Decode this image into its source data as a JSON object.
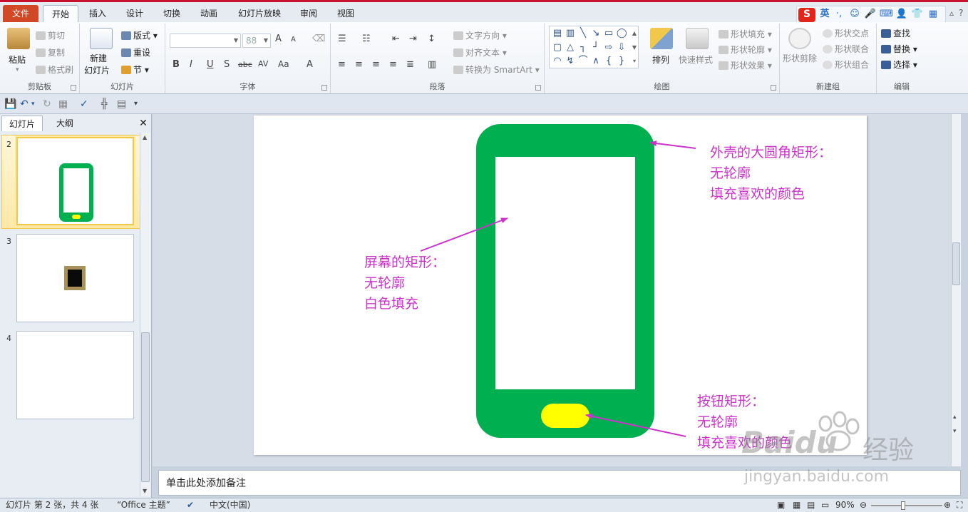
{
  "tabs": [
    "文件",
    "开始",
    "插入",
    "设计",
    "切换",
    "动画",
    "幻灯片放映",
    "审阅",
    "视图"
  ],
  "active_tab": "开始",
  "ime": {
    "logo": "S",
    "lang": "英",
    "punct": "·,"
  },
  "ribbon": {
    "clipboard": {
      "label": "剪贴板",
      "paste": "粘贴",
      "cut": "剪切",
      "copy": "复制",
      "format_painter": "格式刷"
    },
    "slides": {
      "label": "幻灯片",
      "new_slide_1": "新建",
      "new_slide_2": "幻灯片",
      "layout": "版式",
      "reset": "重设",
      "section": "节"
    },
    "font": {
      "label": "字体",
      "font_size": "88",
      "bold": "B",
      "italic": "I",
      "underline": "U",
      "shadow": "S",
      "strike": "abc",
      "spacing": "AV",
      "case": "Aa",
      "color": "A",
      "grow": "A",
      "shrink": "A"
    },
    "paragraph": {
      "label": "段落",
      "text_direction": "文字方向",
      "align_text": "对齐文本",
      "smartart": "转换为 SmartArt"
    },
    "drawing": {
      "label": "绘图",
      "arrange": "排列",
      "quick_styles": "快速样式",
      "shape_fill": "形状填充",
      "shape_outline": "形状轮廓",
      "shape_effects": "形状效果"
    },
    "new_group": {
      "label": "新建组",
      "shape_cut": "形状剪除",
      "shape_intersect": "形状交点",
      "shape_union": "形状联合",
      "shape_combine": "形状组合"
    },
    "editing": {
      "label": "编辑",
      "find": "查找",
      "replace": "替换",
      "select": "选择"
    }
  },
  "panel": {
    "tab_slides": "幻灯片",
    "tab_outline": "大纲",
    "slides": [
      {
        "num": "2"
      },
      {
        "num": "3"
      },
      {
        "num": "4"
      }
    ]
  },
  "slide": {
    "annotations": {
      "shell": [
        "外壳的大圆角矩形：",
        "无轮廓",
        "填充喜欢的颜色"
      ],
      "screen": [
        "屏幕的矩形：",
        "无轮廓",
        "白色填充"
      ],
      "button": [
        "按钮矩形：",
        "无轮廓",
        "填充喜欢的颜色"
      ]
    },
    "colors": {
      "phone_body": "#00b050",
      "button": "#ffff00",
      "screen": "#ffffff",
      "annotation": "#cc33cc"
    }
  },
  "notes_placeholder": "单击此处添加备注",
  "status": {
    "slide_info": "幻灯片 第 2 张，共 4 张",
    "theme": "“Office 主题”",
    "language": "中文(中国)",
    "zoom": "90%"
  },
  "watermark": {
    "brand": "Baidu",
    "cn": "经验",
    "url": "jingyan.baidu.com"
  }
}
